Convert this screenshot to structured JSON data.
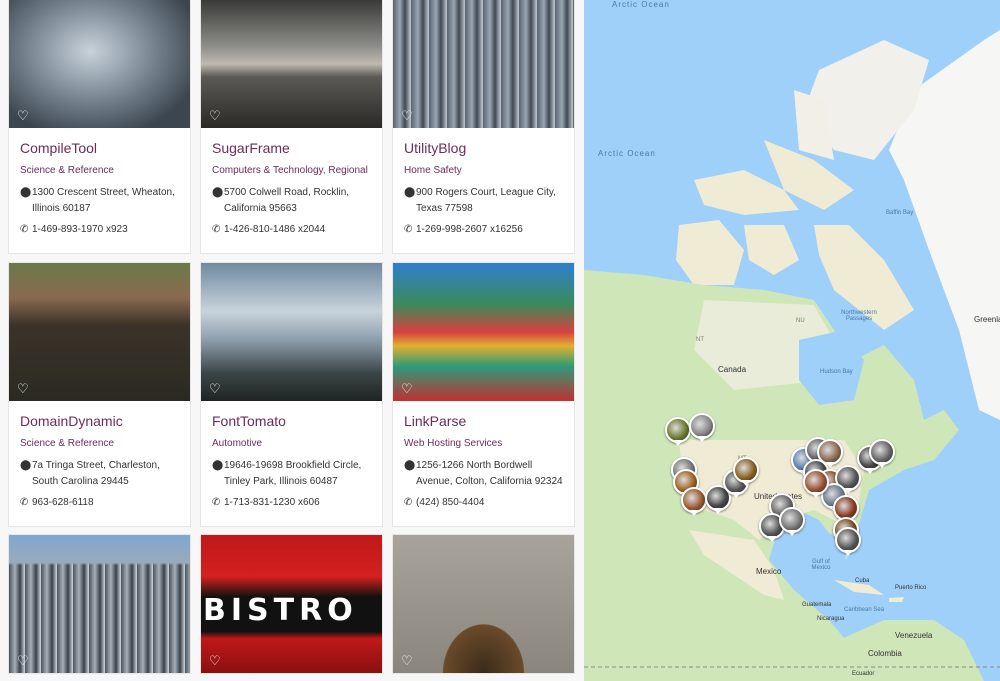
{
  "listings": [
    {
      "name": "CompileTool",
      "category": "Science & Reference",
      "address": "1300 Crescent Street, Wheaton, Illinois 60187",
      "phone": "1-469-893-1970 x923",
      "image": "stone-cherub-statue"
    },
    {
      "name": "SugarFrame",
      "category": "Computers & Technology, Regional",
      "address": "5700 Colwell Road, Rocklin, California 95663",
      "phone": "1-426-810-1486 x2044",
      "image": "lake-dock"
    },
    {
      "name": "UtilityBlog",
      "category": "Home Safety",
      "address": "900 Rogers Court, League City, Texas 77598",
      "phone": "1-269-998-2607 x16256",
      "image": "city-skyline"
    },
    {
      "name": "DomainDynamic",
      "category": "Science & Reference",
      "address": "7a Tringa Street, Charleston, South Carolina 29445",
      "phone": "963-628-6118",
      "image": "tiled-roof-patio"
    },
    {
      "name": "FontTomato",
      "category": "Automotive",
      "address": "19646-19698 Brookfield Circle, Tinley Park, Illinois 60487",
      "phone": "1-713-831-1230 x606",
      "image": "misty-mountains"
    },
    {
      "name": "LinkParse",
      "category": "Web Hosting Services",
      "address": "1256-1266 North Bordwell Avenue, Colton, California 92324",
      "phone": "(424) 850-4404",
      "image": "colorful-umbrellas-cafe"
    },
    {
      "image": "aerial-city"
    },
    {
      "image": "bistro-sign",
      "sign": "BISTRO"
    },
    {
      "image": "ornate-archway"
    }
  ],
  "icons": {
    "favorite": "heart-icon",
    "address": "map-marker-icon",
    "phone": "phone-icon"
  },
  "colors": {
    "accent": "#6b2c5c",
    "ocean": "#9fd0f9",
    "land": "#f0ebd4",
    "forest": "#cfe6b8"
  },
  "map": {
    "labels": {
      "arctic_top": "Arctic Ocean",
      "arctic": "Arctic Ocean",
      "baffin": "Baffin Bay",
      "greenland": "Greenland",
      "nw_passages": "Northwestern Passages",
      "canada": "Canada",
      "hudson": "Hudson Bay",
      "nu": "NU",
      "nt": "NT",
      "mt": "MT",
      "us": "United States",
      "mexico": "Mexico",
      "gulf": "Gulf of Mexico",
      "cuba": "Cuba",
      "puerto_rico": "Puerto Rico",
      "guatemala": "Guatemala",
      "caribbean": "Caribbean Sea",
      "nicaragua": "Nicaragua",
      "venezuela": "Venezuela",
      "colombia": "Colombia",
      "ecuador": "Ecuador"
    }
  }
}
